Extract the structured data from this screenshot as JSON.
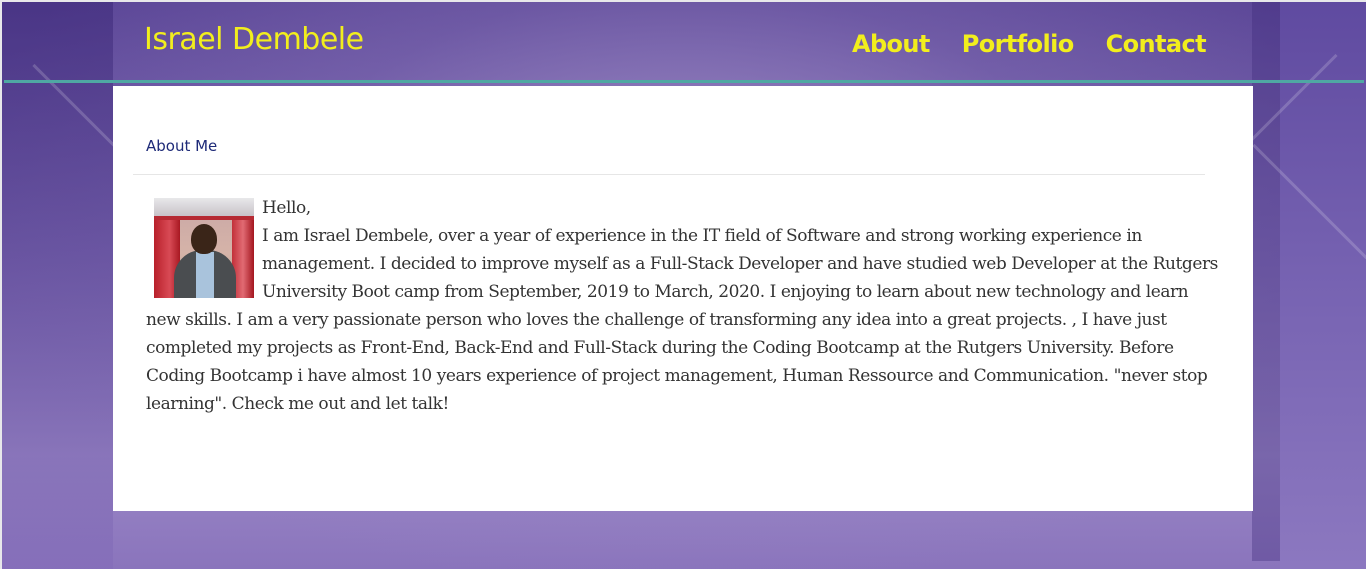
{
  "header": {
    "brand": "Israel Dembele",
    "nav": [
      {
        "label": "About"
      },
      {
        "label": "Portfolio"
      },
      {
        "label": "Contact"
      }
    ]
  },
  "about": {
    "title": "About Me",
    "greeting": "Hello,",
    "body": "I am Israel Dembele, over a year of experience in the IT field of Software and strong working experience in management. I decided to improve myself as a Full-Stack Developer and have studied web Developer at the Rutgers University Boot camp from September, 2019 to March, 2020. I enjoying to learn about new technology and learn new skills. I am a very passionate person who loves the challenge of transforming any idea into a great projects. , I have just completed my projects as Front-End, Back-End and Full-Stack during the Coding Bootcamp at the Rutgers University. Before Coding Bootcamp i have almost 10 years experience of project management, Human Ressource and Communication. \"never stop learning\". Check me out and let talk!"
  },
  "colors": {
    "accent_yellow": "#f2ee1d",
    "rule_teal": "#4fa8a3",
    "title_navy": "#1e2a78",
    "background_purple": "#6f5aa6"
  }
}
